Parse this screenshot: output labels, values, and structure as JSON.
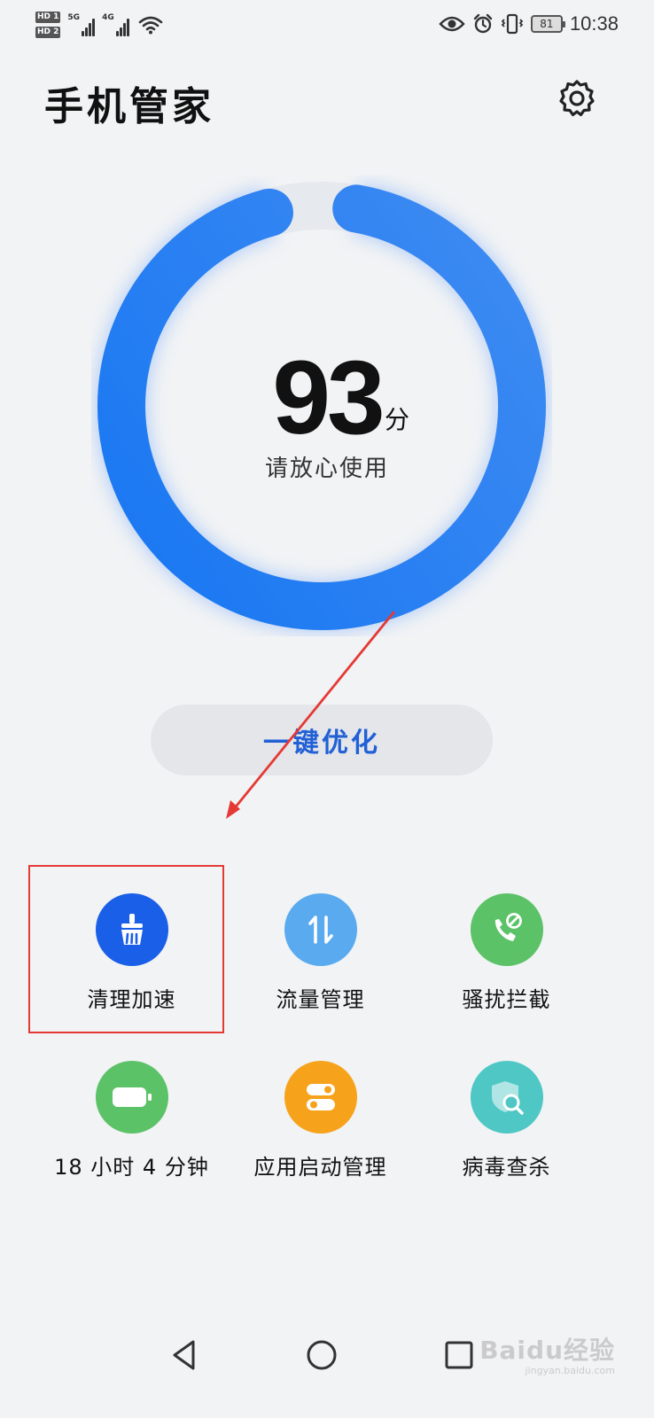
{
  "status_bar": {
    "sim1": "HD 1",
    "sim2": "HD 2",
    "net1": "5G",
    "net2": "4G",
    "battery": "81",
    "time": "10:38"
  },
  "header": {
    "title": "手机管家",
    "settings_icon": "gear-icon"
  },
  "score": {
    "value": "93",
    "unit": "分",
    "status": "请放心使用",
    "ring_fraction": 0.93,
    "ring_color": "#2f7ff0"
  },
  "optimize_button": {
    "label": "一键优化"
  },
  "tools": [
    {
      "label": "清理加速",
      "icon": "broom-icon",
      "color": "#1a5fe8"
    },
    {
      "label": "流量管理",
      "icon": "data-transfer-icon",
      "color": "#5aaaf0"
    },
    {
      "label": "骚扰拦截",
      "icon": "call-block-icon",
      "color": "#5cc267"
    },
    {
      "label": "18 小时 4 分钟",
      "icon": "battery-icon",
      "color": "#5cc267"
    },
    {
      "label": "应用启动管理",
      "icon": "toggle-switch-icon",
      "color": "#f7a21b"
    },
    {
      "label": "病毒查杀",
      "icon": "shield-search-icon",
      "color": "#4fc7c5"
    }
  ],
  "annotation": {
    "arrow_color": "#e53935",
    "box_color": "#e53935"
  },
  "watermark": {
    "text": "Baidu经验",
    "sub": "jingyan.baidu.com"
  }
}
